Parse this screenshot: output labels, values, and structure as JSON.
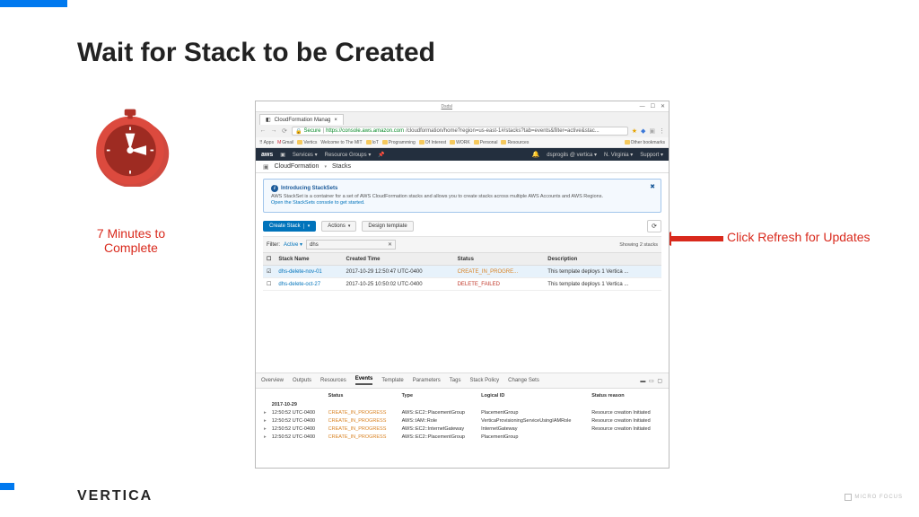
{
  "slide": {
    "title": "Wait for Stack to be Created",
    "caption": "7 Minutes to Complete",
    "annotation": "Click Refresh for Updates",
    "footer": "VERTICA",
    "micro_focus": "MICRO FOCUS"
  },
  "browser": {
    "window_title": "Dsdsl",
    "tab_title": "CloudFormation Manag",
    "url_secure": "Secure",
    "url_host": "https://console.aws.amazon.com",
    "url_path": "/cloudformation/home?region=us-east-1#/stacks?tab=events&filter=active&stac...",
    "bookmarks": [
      "Apps",
      "Gmail",
      "Vertics",
      "Welcome to The MIT",
      "IoT",
      "Programming",
      "Of Interest",
      "WORK",
      "Personal",
      "Resources",
      "Other bookmarks"
    ]
  },
  "aws_bar": {
    "logo": "aws",
    "services": "Services",
    "resource_groups": "Resource Groups",
    "user": "dsprogils @ vertica",
    "region": "N. Virginia",
    "support": "Support"
  },
  "cf_bar": {
    "app": "CloudFormation",
    "page": "Stacks"
  },
  "banner": {
    "title": "Introducing StackSets",
    "body": "AWS StackSet is a container for a set of AWS CloudFormation stacks and allows you to create stacks across multiple AWS Accounts and AWS Regions.",
    "link": "Open the StackSets console to get started."
  },
  "actions": {
    "create_stack": "Create Stack",
    "actions": "Actions",
    "design_template": "Design template",
    "showing": "Showing 2 stacks",
    "filter_label": "Filter:",
    "filter_selection": "Active",
    "filter_text": "dhs"
  },
  "stacks_table": {
    "headers": {
      "name": "Stack Name",
      "created": "Created Time",
      "status": "Status",
      "desc": "Description"
    },
    "rows": [
      {
        "name": "dhs-delete-nov-01",
        "created": "2017-10-29 12:50:47 UTC-0400",
        "status": "CREATE_IN_PROGRE...",
        "desc": "This template deploys 1 Vertica ..."
      },
      {
        "name": "dhs-delete-oct-27",
        "created": "2017-10-25 10:50:02 UTC-0400",
        "status": "DELETE_FAILED",
        "desc": "This template deploys 1 Vertica ..."
      }
    ]
  },
  "detail_tabs": [
    "Overview",
    "Outputs",
    "Resources",
    "Events",
    "Template",
    "Parameters",
    "Tags",
    "Stack Policy",
    "Change Sets"
  ],
  "events": {
    "date": "2017-10-29",
    "headers": {
      "status": "Status",
      "type": "Type",
      "logical": "Logical ID",
      "reason": "Status reason"
    },
    "rows": [
      {
        "time": "12:50:52 UTC-0400",
        "status": "CREATE_IN_PROGRESS",
        "type": "AWS::EC2::PlacementGroup",
        "logical": "PlacementGroup",
        "reason": "Resource creation Initiated"
      },
      {
        "time": "12:50:52 UTC-0400",
        "status": "CREATE_IN_PROGRESS",
        "type": "AWS::IAM::Role",
        "logical": "VerticaProvisioningServiceUsingIAMRole",
        "reason": "Resource creation Initiated"
      },
      {
        "time": "12:50:52 UTC-0400",
        "status": "CREATE_IN_PROGRESS",
        "type": "AWS::EC2::InternetGateway",
        "logical": "InternetGateway",
        "reason": "Resource creation Initiated"
      },
      {
        "time": "12:50:52 UTC-0400",
        "status": "CREATE_IN_PROGRESS",
        "type": "AWS::EC2::PlacementGroup",
        "logical": "PlacementGroup",
        "reason": ""
      }
    ]
  }
}
